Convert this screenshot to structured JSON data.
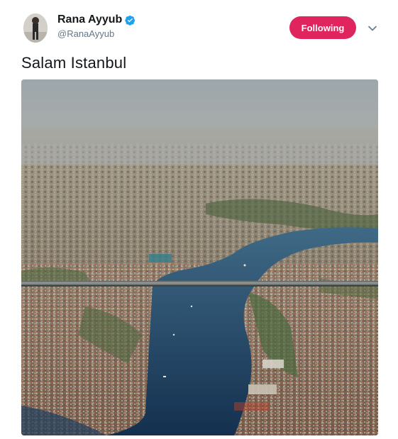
{
  "user": {
    "name": "Rana Ayyub",
    "handle": "@RanaAyyub",
    "verified": true
  },
  "follow_button": {
    "label": "Following",
    "color": "#e0245e"
  },
  "tweet": {
    "text": "Salam Istanbul"
  },
  "icons": {
    "verified": "verified-badge-icon",
    "menu": "chevron-down-icon"
  },
  "colors": {
    "accent": "#1da1f2",
    "following": "#e0245e",
    "text": "#14171a",
    "muted": "#657786"
  }
}
